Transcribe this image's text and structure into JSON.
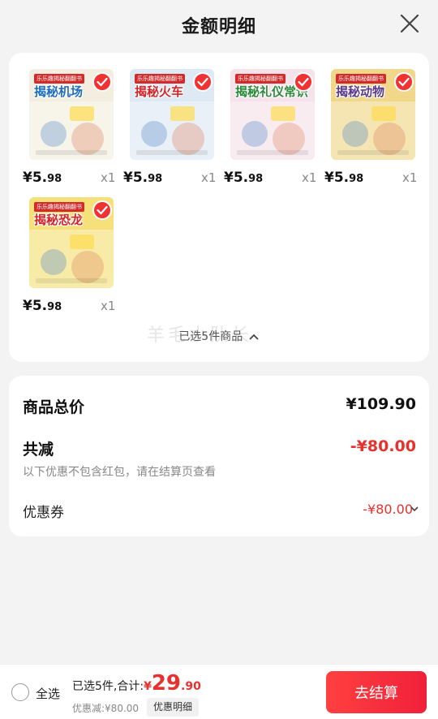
{
  "header": {
    "title": "金额明细"
  },
  "products": [
    {
      "title": "揭秘机场",
      "series": "乐乐趣揭秘翻翻书",
      "price_int": "¥5.",
      "price_dec": "98",
      "qty": "x1",
      "cover_bg": "#f3eedf",
      "title_color": "#1f6fbf"
    },
    {
      "title": "揭秘火车",
      "series": "乐乐趣揭秘翻翻书",
      "price_int": "¥5.",
      "price_dec": "98",
      "qty": "x1",
      "cover_bg": "#dfe9f3",
      "title_color": "#d3262a"
    },
    {
      "title": "揭秘礼仪常识",
      "series": "乐乐趣揭秘翻翻书",
      "price_int": "¥5.",
      "price_dec": "98",
      "qty": "x1",
      "cover_bg": "#f6e2ea",
      "title_color": "#2c8a3a"
    },
    {
      "title": "揭秘动物",
      "series": "乐乐趣揭秘翻翻书",
      "price_int": "¥5.",
      "price_dec": "98",
      "qty": "x1",
      "cover_bg": "#f0d78a",
      "title_color": "#5a3b8c"
    },
    {
      "title": "揭秘恐龙",
      "series": "乐乐趣揭秘翻翻书",
      "price_int": "¥5.",
      "price_dec": "98",
      "qty": "x1",
      "cover_bg": "#f5e07a",
      "title_color": "#d3262a"
    }
  ],
  "selected_summary": "已选5件商品",
  "watermark": "羊毛小队长",
  "totals": {
    "goods_label": "商品总价",
    "goods_value": "¥109.90",
    "reduce_label": "共减",
    "reduce_value": "-¥80.00",
    "note": "以下优惠不包含红包，请在结算页查看",
    "coupon_label": "优惠券",
    "coupon_value": "-¥80.00"
  },
  "bottom": {
    "select_all": "全选",
    "count_text": "已选5件,合计:",
    "currency": "¥",
    "total_int": "29",
    "total_dec": ".90",
    "discount": "优惠减:¥80.00",
    "detail_button": "优惠明细",
    "checkout_button": "去结算"
  },
  "colors": {
    "accent_red": "#e8312c"
  }
}
